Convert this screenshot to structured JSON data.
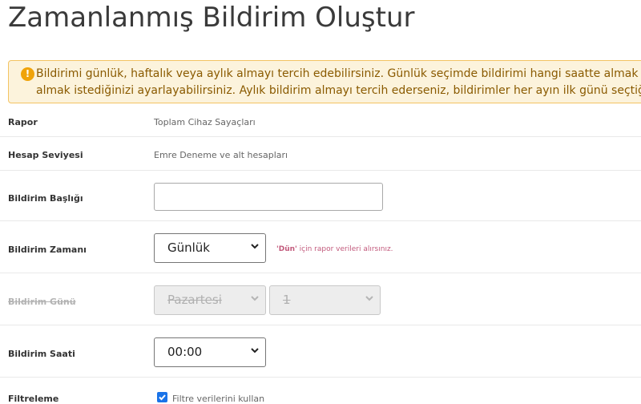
{
  "page": {
    "title": "Zamanlanmış Bildirim Oluştur"
  },
  "alert": {
    "icon": "exclamation-circle-icon",
    "line1": "Bildirimi günlük, haftalık veya aylık almayı tercih edebilirsiniz. Günlük seçimde bildirimi hangi saatte almak istediğinizi,",
    "line2": "almak istediğinizi ayarlayabilirsiniz. Aylık bildirim almayı tercih ederseniz, bildirimler her ayın ilk günü seçtiğiniz"
  },
  "form": {
    "report": {
      "label": "Rapor",
      "value": "Toplam Cihaz Sayaçları"
    },
    "account_level": {
      "label": "Hesap Seviyesi",
      "value": "Emre Deneme ve alt hesapları"
    },
    "notification_title": {
      "label": "Bildirim Başlığı",
      "value": "",
      "placeholder": ""
    },
    "notification_time": {
      "label": "Bildirim Zamanı",
      "selected": "Günlük",
      "hint_bold": "'Dün'",
      "hint_rest": " için rapor verileri alırsınız."
    },
    "notification_day": {
      "label": "Bildirim Günü",
      "weekday": "Pazartesi",
      "day_number": "1"
    },
    "notification_hour": {
      "label": "Bildirim Saati",
      "selected": "00:00"
    },
    "filter": {
      "label": "Filtreleme",
      "checkbox_label": "Filtre verilerini kullan",
      "checked": true
    }
  },
  "colors": {
    "alert_bg": "#fcf3dc",
    "alert_border": "#f3c463",
    "alert_text": "#8a5a00",
    "hint_text": "#c25a7c",
    "checkbox": "#1a73e8"
  }
}
